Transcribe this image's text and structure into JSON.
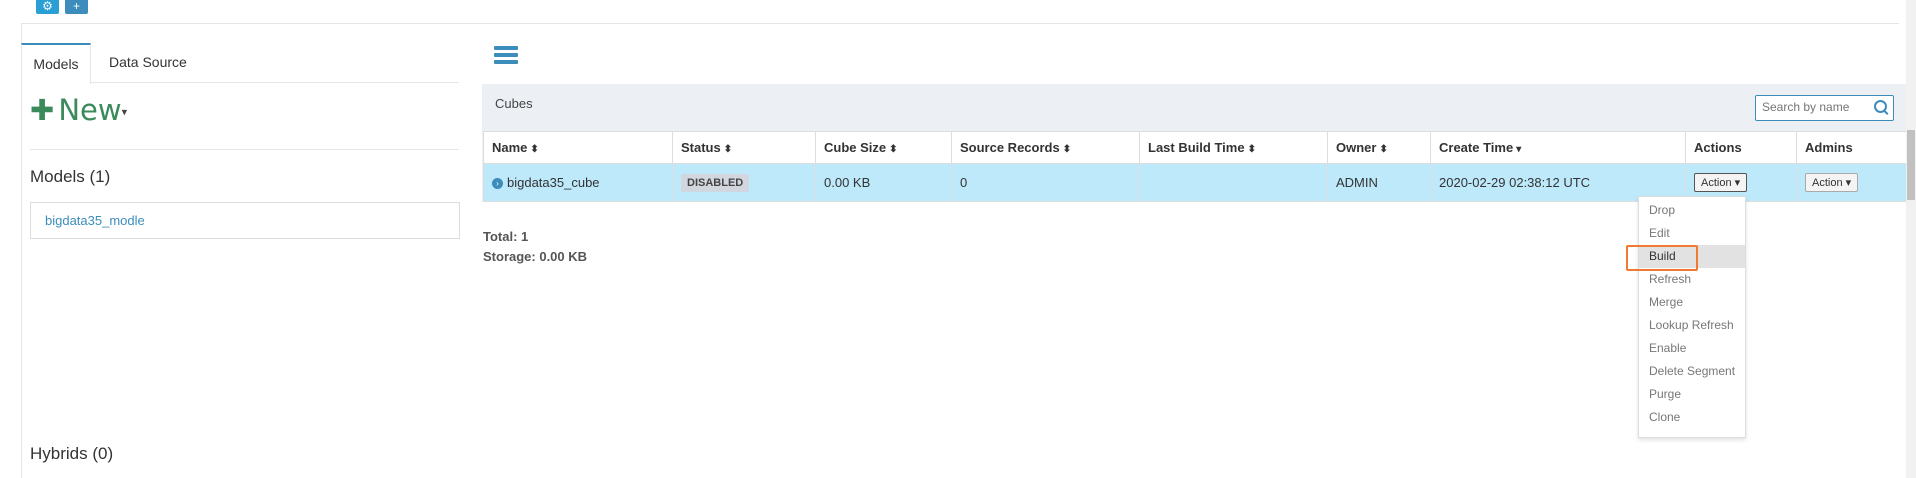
{
  "header": {
    "icons": [
      "gear-icon",
      "plus-icon"
    ]
  },
  "left": {
    "tabs": [
      {
        "label": "Models",
        "active": true
      },
      {
        "label": "Data Source",
        "active": false
      }
    ],
    "new_label": "New",
    "models_title": "Models (1)",
    "models": [
      "bigdata35_modle"
    ],
    "hybrids_title": "Hybrids (0)"
  },
  "cubes_panel": {
    "title": "Cubes",
    "search_placeholder": "Search by name",
    "columns": [
      "Name",
      "Status",
      "Cube Size",
      "Source Records",
      "Last Build Time",
      "Owner",
      "Create Time",
      "Actions",
      "Admins"
    ],
    "rows": [
      {
        "name": "bigdata35_cube",
        "status": "DISABLED",
        "cube_size": "0.00 KB",
        "source_records": "0",
        "last_build_time": "",
        "owner": "ADMIN",
        "create_time": "2020-02-29 02:38:12 UTC",
        "action_label": "Action",
        "admin_label": "Action"
      }
    ],
    "total": "Total: 1",
    "storage": "Storage: 0.00 KB"
  },
  "action_menu": {
    "items": [
      "Drop",
      "Edit",
      "Build",
      "Refresh",
      "Merge",
      "Lookup Refresh",
      "Enable",
      "Delete Segment",
      "Purge",
      "Clone"
    ],
    "highlighted": "Build"
  },
  "colors": {
    "accent": "#3c8dbc",
    "new_button": "#3b8a5c",
    "selected_row": "#bde9fb",
    "highlight_outline": "#f07a2f"
  }
}
